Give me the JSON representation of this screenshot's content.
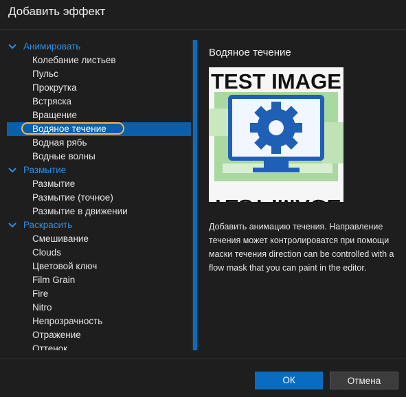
{
  "dialog": {
    "title": "Добавить эффект",
    "ok_label": "ОК",
    "cancel_label": "Отмена"
  },
  "list": {
    "categories": [
      {
        "label": "Анимировать",
        "items": [
          "Колебание листьев",
          "Пульс",
          "Прокрутка",
          "Встряска",
          "Вращение",
          "Водяное течение",
          "Водная рябь",
          "Водные волны"
        ]
      },
      {
        "label": "Размытие",
        "items": [
          "Размытие",
          "Размытие (точное)",
          "Размытие в движении"
        ]
      },
      {
        "label": "Раскрасить",
        "items": [
          "Смешивание",
          "Clouds",
          "Цветовой ключ",
          "Film Grain",
          "Fire",
          "Nitro",
          "Непрозрачность",
          "Отражение",
          "Оттенок"
        ]
      }
    ],
    "selected": "Водяное течение"
  },
  "detail": {
    "title": "Водяное течение",
    "preview_text": "TEST IMAGE",
    "description": "Добавить анимацию течения. Направление течения может контролироватся при помощи маски течения direction can be controlled with a flow mask that you can paint in the editor."
  },
  "colors": {
    "accent": "#0a6cc1",
    "category": "#2f8fe0",
    "selection_outline": "#f4b75a"
  }
}
